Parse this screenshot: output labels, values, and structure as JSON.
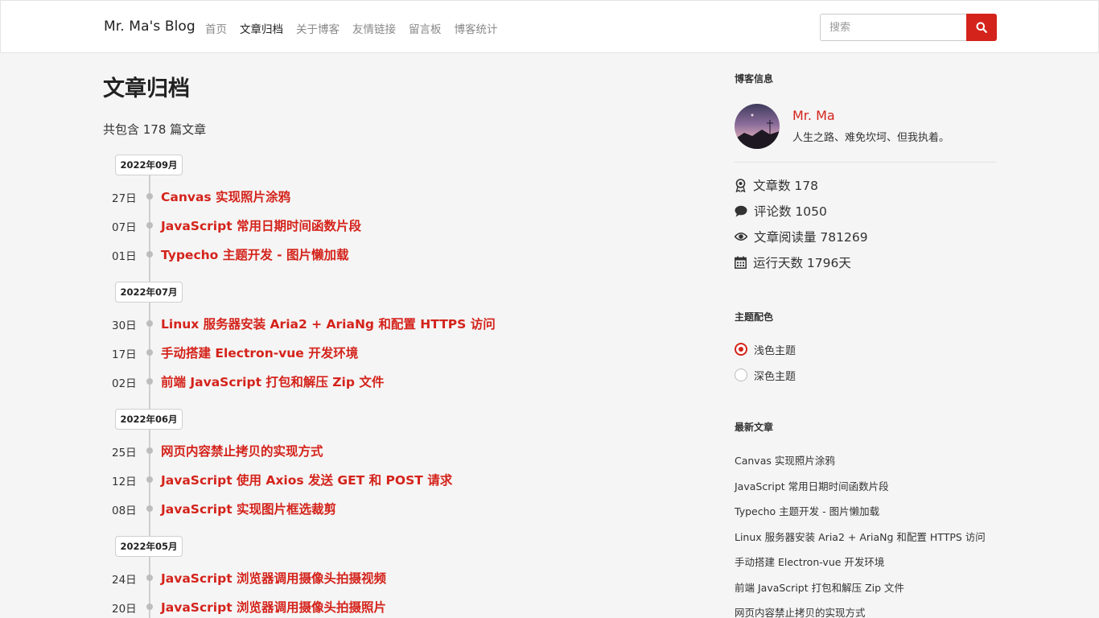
{
  "header": {
    "brand": "Mr. Ma's Blog",
    "nav": [
      "首页",
      "文章归档",
      "关于博客",
      "友情链接",
      "留言板",
      "博客统计"
    ],
    "active_nav": "文章归档",
    "search_placeholder": "搜索",
    "search_icon": "search-icon",
    "accent_color": "#d4231b"
  },
  "main": {
    "title": "文章归档",
    "total": "共包含 178 篇文章",
    "months": [
      {
        "label": "2022年09月",
        "posts": [
          {
            "day": "27日",
            "title": "Canvas 实现照片涂鸦"
          },
          {
            "day": "07日",
            "title": "JavaScript 常用日期时间函数片段"
          },
          {
            "day": "01日",
            "title": "Typecho 主题开发 - 图片懒加载"
          }
        ]
      },
      {
        "label": "2022年07月",
        "posts": [
          {
            "day": "30日",
            "title": "Linux 服务器安装 Aria2 + AriaNg 和配置 HTTPS 访问"
          },
          {
            "day": "17日",
            "title": "手动搭建 Electron-vue 开发环境"
          },
          {
            "day": "02日",
            "title": "前端 JavaScript 打包和解压 Zip 文件"
          }
        ]
      },
      {
        "label": "2022年06月",
        "posts": [
          {
            "day": "25日",
            "title": "网页内容禁止拷贝的实现方式"
          },
          {
            "day": "12日",
            "title": "JavaScript 使用 Axios 发送 GET 和 POST 请求"
          },
          {
            "day": "08日",
            "title": "JavaScript 实现图片框选裁剪"
          }
        ]
      },
      {
        "label": "2022年05月",
        "posts": [
          {
            "day": "24日",
            "title": "JavaScript 浏览器调用摄像头拍摄视频"
          },
          {
            "day": "20日",
            "title": "JavaScript 浏览器调用摄像头拍摄照片"
          }
        ]
      }
    ]
  },
  "sidebar": {
    "blog_info_heading": "博客信息",
    "author_name": "Mr. Ma",
    "author_motto": "人生之路、难免坎坷、但我执着。",
    "stats": [
      {
        "icon": "award-icon",
        "text": "文章数 178"
      },
      {
        "icon": "comment-icon",
        "text": "评论数 1050"
      },
      {
        "icon": "eye-icon",
        "text": "文章阅读量 781269"
      },
      {
        "icon": "calendar-icon",
        "text": "运行天数 1796天"
      }
    ],
    "theme_heading": "主题配色",
    "themes": [
      {
        "label": "浅色主题",
        "selected": true
      },
      {
        "label": "深色主题",
        "selected": false
      }
    ],
    "recent_heading": "最新文章",
    "recent_posts": [
      "Canvas 实现照片涂鸦",
      "JavaScript 常用日期时间函数片段",
      "Typecho 主题开发 - 图片懒加载",
      "Linux 服务器安装 Aria2 + AriaNg 和配置 HTTPS 访问",
      "手动搭建 Electron-vue 开发环境",
      "前端 JavaScript 打包和解压 Zip 文件",
      "网页内容禁止拷贝的实现方式"
    ]
  }
}
